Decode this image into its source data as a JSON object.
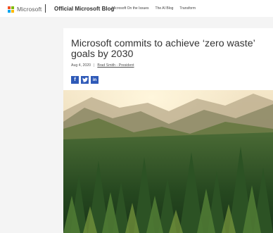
{
  "brand": {
    "name": "Microsoft",
    "logo_colors": [
      "#f25022",
      "#7fba00",
      "#00a4ef",
      "#ffb900"
    ]
  },
  "header": {
    "blog_name": "Official Microsoft Blog",
    "nav": [
      {
        "label": "Microsoft On the Issues"
      },
      {
        "label": "The AI Blog"
      },
      {
        "label": "Transform"
      }
    ]
  },
  "article": {
    "title": "Microsoft commits to achieve ‘zero waste’ goals by 2030",
    "date": "Aug 4, 2020",
    "separator": "|",
    "author": "Brad Smith - President",
    "share": {
      "facebook": "f",
      "twitter": "t",
      "linkedin": "in"
    },
    "hero_icon": "forest-landscape-image"
  },
  "colors": {
    "share_button": "#2f5ab8",
    "page_bg": "#f4f4f4"
  }
}
